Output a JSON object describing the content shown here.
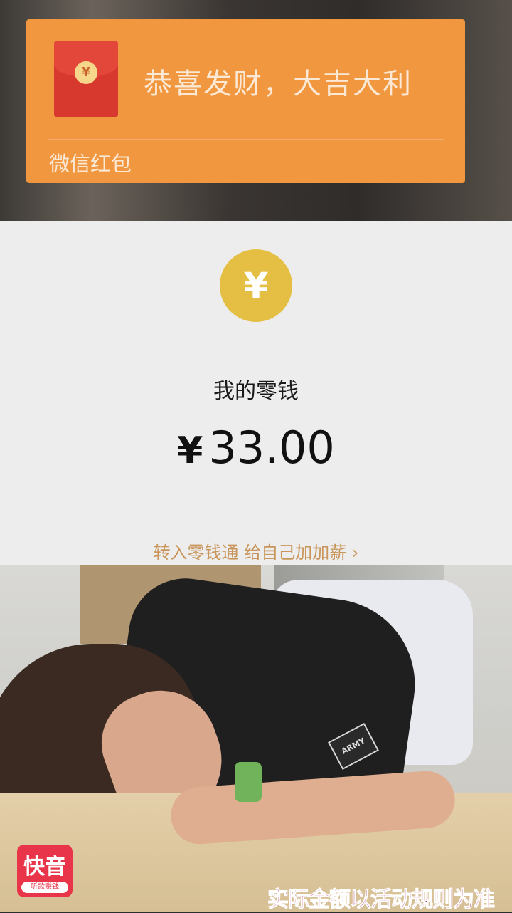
{
  "red_packet": {
    "title": "恭喜发财，大吉大利",
    "source": "微信红包",
    "coin_symbol": "¥"
  },
  "wallet": {
    "icon_symbol": "¥",
    "label": "我的零钱",
    "currency_symbol": "¥",
    "amount": "33.00",
    "promo_link": "转入零钱通 给自己加加薪 ›"
  },
  "photo": {
    "badge_text": "ARMY"
  },
  "watermark": {
    "app_name": "快音",
    "slogan": "听歌赚钱"
  },
  "caption": "实际金额以活动规则为准",
  "colors": {
    "packet": "#f0973f",
    "envelope": "#d8392f",
    "yuan_circle": "#e5be44",
    "promo_text": "#c9955a",
    "logo": "#e8354a",
    "caption": "#b1155a"
  }
}
